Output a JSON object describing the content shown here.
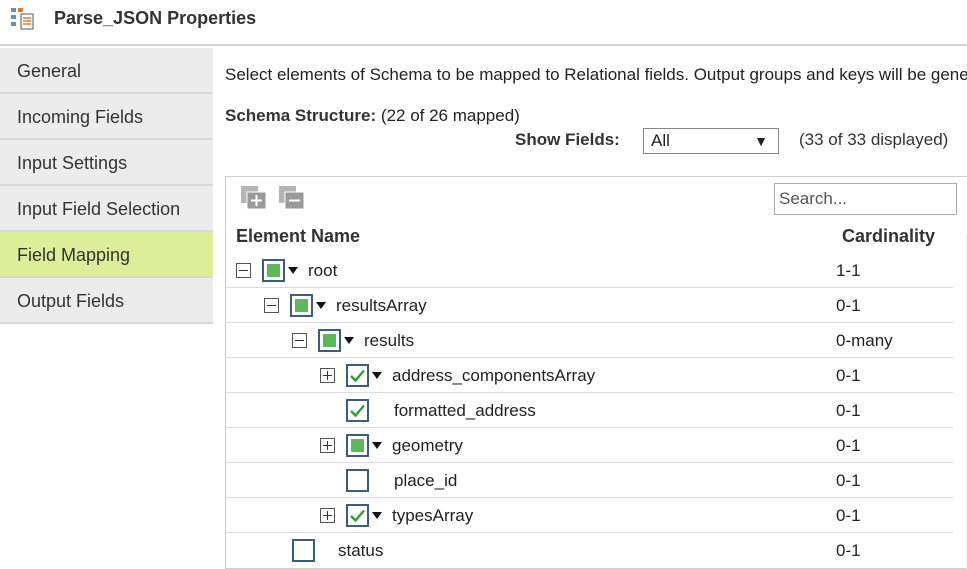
{
  "window": {
    "title": "Parse_JSON Properties",
    "icon": "transformation-icon"
  },
  "sidebar": {
    "items": [
      {
        "label": "General",
        "active": false
      },
      {
        "label": "Incoming Fields",
        "active": false
      },
      {
        "label": "Input Settings",
        "active": false
      },
      {
        "label": "Input Field Selection",
        "active": false
      },
      {
        "label": "Field Mapping",
        "active": true
      },
      {
        "label": "Output Fields",
        "active": false
      }
    ]
  },
  "main": {
    "description": "Select elements of Schema to be mapped to Relational fields. Output groups and keys will be generated.",
    "schema_label": "Schema Structure:",
    "schema_count": "(22 of 26 mapped)",
    "show_fields_label": "Show Fields:",
    "show_fields_value": "All",
    "displayed_count": "(33 of 33 displayed)"
  },
  "tree": {
    "search_placeholder": "Search...",
    "col_name": "Element Name",
    "col_cardinality": "Cardinality",
    "rows": [
      {
        "name": "root",
        "cardinality": "1-1"
      },
      {
        "name": "resultsArray",
        "cardinality": "0-1"
      },
      {
        "name": "results",
        "cardinality": "0-many"
      },
      {
        "name": "address_componentsArray",
        "cardinality": "0-1"
      },
      {
        "name": "formatted_address",
        "cardinality": "0-1"
      },
      {
        "name": "geometry",
        "cardinality": "0-1"
      },
      {
        "name": "place_id",
        "cardinality": "0-1"
      },
      {
        "name": "typesArray",
        "cardinality": "0-1"
      },
      {
        "name": "status",
        "cardinality": "0-1"
      }
    ]
  },
  "colors": {
    "active_tab": "#ddee99",
    "partial_fill": "#5cb85c",
    "check": "#2e9e2e"
  }
}
